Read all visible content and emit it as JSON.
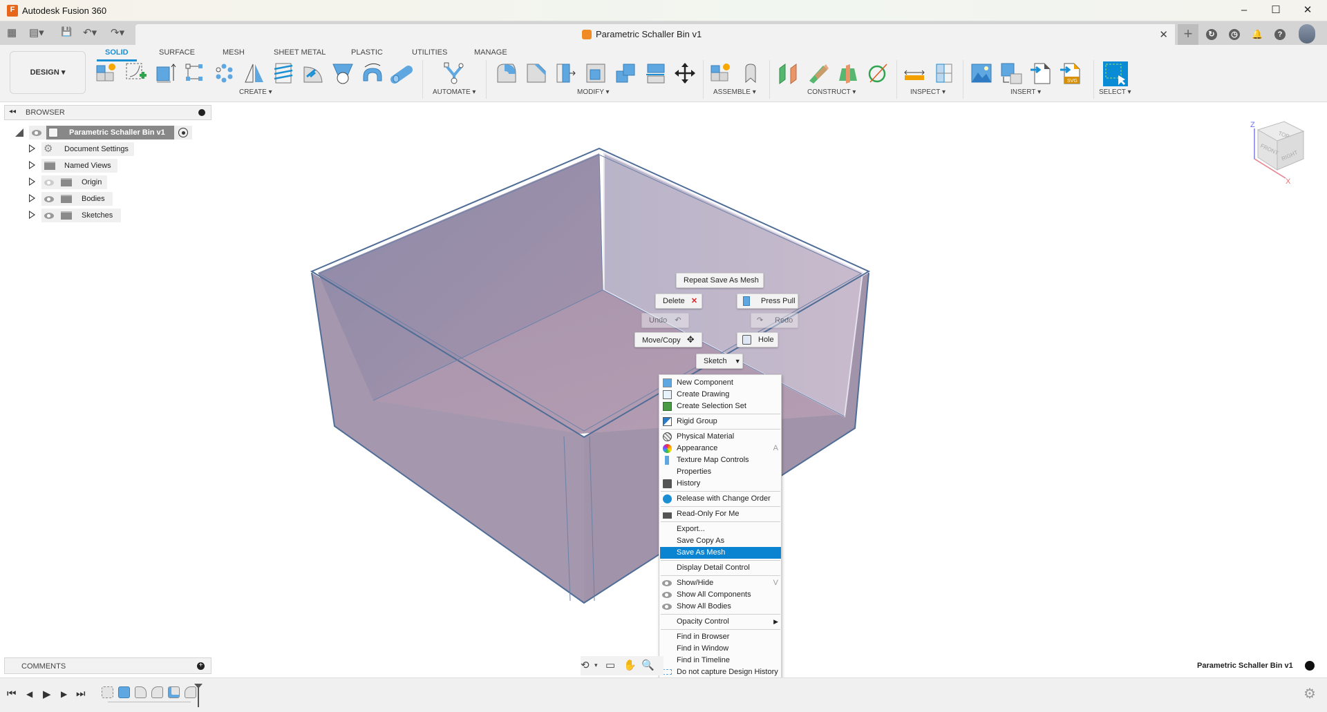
{
  "window": {
    "app_title": "Autodesk Fusion 360",
    "logo_letter": "F",
    "controls": {
      "minimize": "–",
      "maximize": "☐",
      "close": "✕"
    }
  },
  "quick_access": {
    "grid_icon": "▦",
    "file_icon": "▤▾",
    "save_icon": "💾",
    "undo_icon": "↶▾",
    "redo_icon": "↷▾"
  },
  "document_tab": {
    "name": "Parametric Schaller Bin v1",
    "close_icon": "✕"
  },
  "right_icons": {
    "new_tab": "+",
    "job_status": "↻",
    "history": "◷",
    "notifications": "🔔",
    "help": "?"
  },
  "toolbar": {
    "workspace": "DESIGN ▾",
    "tabs": [
      {
        "label": "SOLID",
        "active": true
      },
      {
        "label": "SURFACE"
      },
      {
        "label": "MESH"
      },
      {
        "label": "SHEET METAL"
      },
      {
        "label": "PLASTIC"
      },
      {
        "label": "UTILITIES"
      },
      {
        "label": "MANAGE"
      }
    ],
    "groups": [
      {
        "label": "CREATE ▾"
      },
      {
        "label": "AUTOMATE ▾"
      },
      {
        "label": "MODIFY ▾"
      },
      {
        "label": "ASSEMBLE ▾"
      },
      {
        "label": "CONSTRUCT ▾"
      },
      {
        "label": "INSPECT ▾"
      },
      {
        "label": "INSERT ▾"
      },
      {
        "label": "SELECT ▾"
      }
    ]
  },
  "browser": {
    "header": "BROWSER",
    "root": "Parametric Schaller Bin v1",
    "items": [
      {
        "label": "Document Settings"
      },
      {
        "label": "Named Views"
      },
      {
        "label": "Origin"
      },
      {
        "label": "Bodies"
      },
      {
        "label": "Sketches"
      }
    ]
  },
  "marking_menu": {
    "repeat": "Repeat Save As Mesh",
    "delete": "Delete",
    "press_pull": "Press Pull",
    "undo": "Undo",
    "redo": "Redo",
    "move_copy": "Move/Copy",
    "hole": "Hole",
    "sketch": "Sketch"
  },
  "context_menu": {
    "items": [
      {
        "label": "New Component"
      },
      {
        "label": "Create Drawing"
      },
      {
        "label": "Create Selection Set"
      },
      {
        "label": "Rigid Group"
      },
      {
        "label": "Physical Material"
      },
      {
        "label": "Appearance",
        "shortcut": "A"
      },
      {
        "label": "Texture Map Controls"
      },
      {
        "label": "Properties"
      },
      {
        "label": "History"
      },
      {
        "label": "Release with Change Order"
      },
      {
        "label": "Read-Only For Me"
      },
      {
        "label": "Export..."
      },
      {
        "label": "Save Copy As"
      },
      {
        "label": "Save As Mesh",
        "selected": true
      },
      {
        "label": "Display Detail Control"
      },
      {
        "label": "Show/Hide",
        "shortcut": "V"
      },
      {
        "label": "Show All Components"
      },
      {
        "label": "Show All Bodies"
      },
      {
        "label": "Opacity Control",
        "submenu": "▶"
      },
      {
        "label": "Find in Browser"
      },
      {
        "label": "Find in Window"
      },
      {
        "label": "Find in Timeline"
      },
      {
        "label": "Do not capture Design History"
      }
    ]
  },
  "viewcube": {
    "top": "TOP",
    "front": "FRONT",
    "right": "RIGHT",
    "z": "Z",
    "x": "X"
  },
  "comments": {
    "header": "COMMENTS"
  },
  "status": {
    "doc_name": "Parametric Schaller Bin v1"
  },
  "timeline": {
    "first": "⏮",
    "prev": "◀",
    "play": "▶",
    "next": "▶",
    "last": "⏭"
  },
  "colors": {
    "accent": "#1a8fd4",
    "selected_menu": "#0a83d1",
    "body_fill": "#a597ae",
    "body_edge": "#4f6d97"
  }
}
